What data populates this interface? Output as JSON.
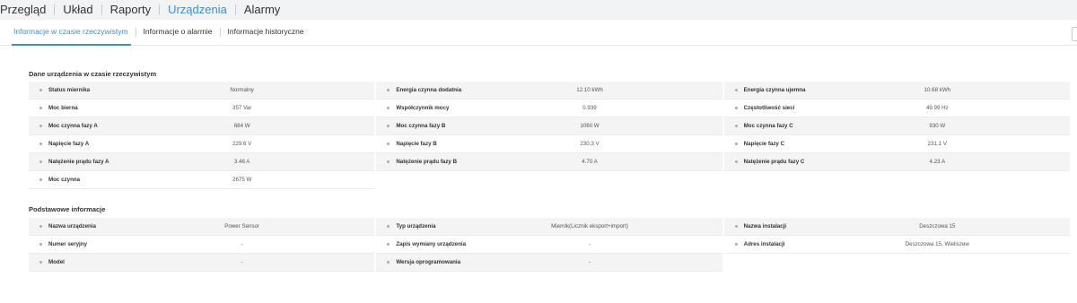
{
  "nav": {
    "items": [
      {
        "label": "Przegląd",
        "active": false
      },
      {
        "label": "Układ",
        "active": false
      },
      {
        "label": "Raporty",
        "active": false
      },
      {
        "label": "Urządzenia",
        "active": true
      },
      {
        "label": "Alarmy",
        "active": false
      }
    ]
  },
  "tabs": [
    {
      "label": "Informacje w czasie rzeczywistym",
      "active": true
    },
    {
      "label": "Informacje o alarmie",
      "active": false
    },
    {
      "label": "Informacje historyczne",
      "active": false
    }
  ],
  "colors": {
    "accent": "#3d8fd1",
    "row_bg": "#f4f4f4"
  },
  "realtime": {
    "title": "Dane urządzenia w czasie rzeczywistym",
    "rows": [
      [
        {
          "label": "Status miernika",
          "value": "Normalny"
        },
        {
          "label": "Energia czynna dodatnia",
          "value": "12.10 kWh"
        },
        {
          "label": "Energia czynna ujemna",
          "value": "10.68 kWh"
        }
      ],
      [
        {
          "label": "Moc bierna",
          "value": "357 Var"
        },
        {
          "label": "Współczynnik mocy",
          "value": "0.939"
        },
        {
          "label": "Częstotliwość sieci",
          "value": "49.99 Hz"
        }
      ],
      [
        {
          "label": "Moc czynna fazy A",
          "value": "684 W"
        },
        {
          "label": "Moc czynna fazy B",
          "value": "1060 W"
        },
        {
          "label": "Moc czynna fazy C",
          "value": "930 W"
        }
      ],
      [
        {
          "label": "Napięcie fazy A",
          "value": "229.6 V"
        },
        {
          "label": "Napięcie fazy B",
          "value": "230.3 V"
        },
        {
          "label": "Napięcie fazy C",
          "value": "231.1 V"
        }
      ],
      [
        {
          "label": "Natężenie prądu fazy A",
          "value": "3.46 A"
        },
        {
          "label": "Natężenie prądu fazy B",
          "value": "4.70 A"
        },
        {
          "label": "Natężenie prądu fazy C",
          "value": "4.23 A"
        }
      ],
      [
        {
          "label": "Moc czynna",
          "value": "2675 W"
        }
      ]
    ]
  },
  "basic": {
    "title": "Podstawowe informacje",
    "rows": [
      [
        {
          "label": "Nazwa urządzenia",
          "value": "Power Sensor"
        },
        {
          "label": "Typ urządzenia",
          "value": "Miernik(Licznik eksport+import)"
        },
        {
          "label": "Nazwa instalacji",
          "value": "Deszczowa 15"
        }
      ],
      [
        {
          "label": "Numer seryjny",
          "value": "-"
        },
        {
          "label": "Zapis wymiany urządzenia",
          "value": "-"
        },
        {
          "label": "Adres instalacji",
          "value": "Deszczowa 15, Wieliszew"
        }
      ],
      [
        {
          "label": "Model",
          "value": "-"
        },
        {
          "label": "Wersja oprogramowania",
          "value": "-"
        }
      ]
    ]
  }
}
